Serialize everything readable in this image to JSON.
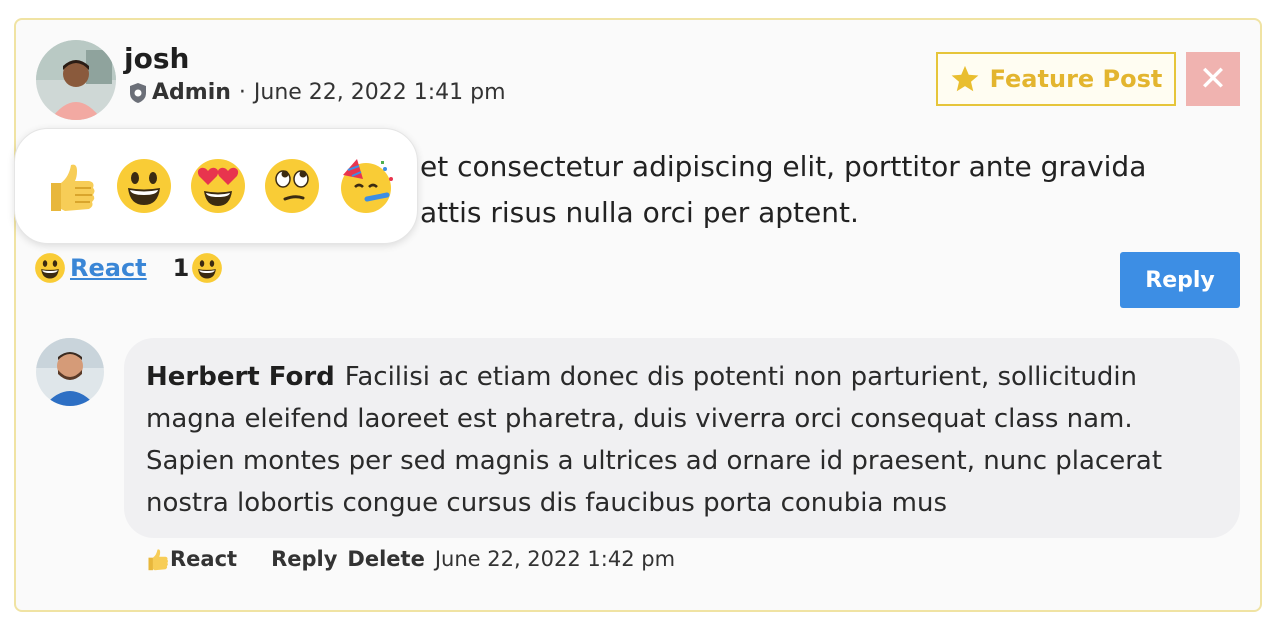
{
  "post": {
    "author": "josh",
    "role": "Admin",
    "separator": "·",
    "timestamp": "June 22, 2022 1:41 pm",
    "feature_label": "Feature Post",
    "close_label": "✕",
    "body_line1": "et consectetur adipiscing elit, porttitor ante gravida",
    "body_line2": "attis risus nulla orci per aptent.",
    "react_label": "React",
    "reaction_count": "1",
    "reply_label": "Reply"
  },
  "reaction_picker": {
    "icons": [
      "thumbs-up-icon",
      "grinning-face-icon",
      "heart-eyes-icon",
      "rolling-eyes-icon",
      "party-face-icon"
    ]
  },
  "comment": {
    "author": "Herbert Ford",
    "text": "Facilisi ac etiam donec dis potenti non parturient, sollicitudin magna eleifend laoreet est pharetra, duis viverra orci consequat class nam. Sapien montes per sed magnis a ultrices ad ornare id praesent, nunc placerat nostra lobortis congue cursus dis faucibus porta conubia mus",
    "react_label": "React",
    "reply_label": "Reply",
    "delete_label": "Delete",
    "timestamp": "June 22, 2022 1:42 pm"
  },
  "colors": {
    "card_border": "#f0e3a3",
    "feature_gold": "#e3b52f",
    "close_pink": "#f0b3b0",
    "reply_blue": "#3d8ee4",
    "link_blue": "#3a86d6"
  }
}
